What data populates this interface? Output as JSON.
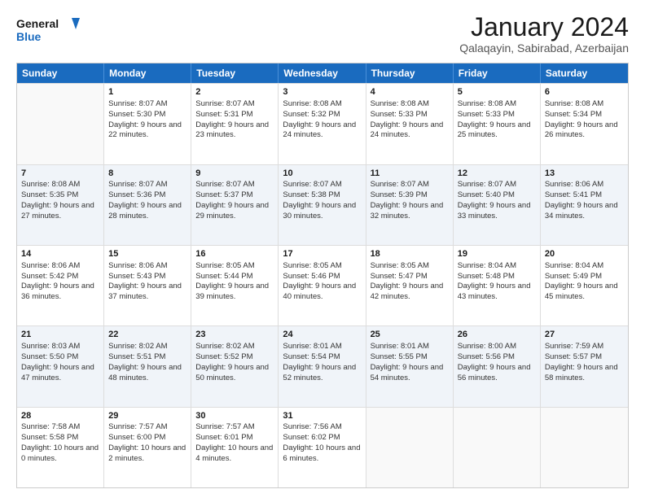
{
  "logo": {
    "line1": "General",
    "line2": "Blue"
  },
  "title": "January 2024",
  "subtitle": "Qalaqayin, Sabirabad, Azerbaijan",
  "header_days": [
    "Sunday",
    "Monday",
    "Tuesday",
    "Wednesday",
    "Thursday",
    "Friday",
    "Saturday"
  ],
  "weeks": [
    [
      {
        "day": "",
        "sunrise": "",
        "sunset": "",
        "daylight": "",
        "alt": false
      },
      {
        "day": "1",
        "sunrise": "Sunrise: 8:07 AM",
        "sunset": "Sunset: 5:30 PM",
        "daylight": "Daylight: 9 hours and 22 minutes.",
        "alt": false
      },
      {
        "day": "2",
        "sunrise": "Sunrise: 8:07 AM",
        "sunset": "Sunset: 5:31 PM",
        "daylight": "Daylight: 9 hours and 23 minutes.",
        "alt": false
      },
      {
        "day": "3",
        "sunrise": "Sunrise: 8:08 AM",
        "sunset": "Sunset: 5:32 PM",
        "daylight": "Daylight: 9 hours and 24 minutes.",
        "alt": false
      },
      {
        "day": "4",
        "sunrise": "Sunrise: 8:08 AM",
        "sunset": "Sunset: 5:33 PM",
        "daylight": "Daylight: 9 hours and 24 minutes.",
        "alt": false
      },
      {
        "day": "5",
        "sunrise": "Sunrise: 8:08 AM",
        "sunset": "Sunset: 5:33 PM",
        "daylight": "Daylight: 9 hours and 25 minutes.",
        "alt": false
      },
      {
        "day": "6",
        "sunrise": "Sunrise: 8:08 AM",
        "sunset": "Sunset: 5:34 PM",
        "daylight": "Daylight: 9 hours and 26 minutes.",
        "alt": false
      }
    ],
    [
      {
        "day": "7",
        "sunrise": "Sunrise: 8:08 AM",
        "sunset": "Sunset: 5:35 PM",
        "daylight": "Daylight: 9 hours and 27 minutes.",
        "alt": true
      },
      {
        "day": "8",
        "sunrise": "Sunrise: 8:07 AM",
        "sunset": "Sunset: 5:36 PM",
        "daylight": "Daylight: 9 hours and 28 minutes.",
        "alt": true
      },
      {
        "day": "9",
        "sunrise": "Sunrise: 8:07 AM",
        "sunset": "Sunset: 5:37 PM",
        "daylight": "Daylight: 9 hours and 29 minutes.",
        "alt": true
      },
      {
        "day": "10",
        "sunrise": "Sunrise: 8:07 AM",
        "sunset": "Sunset: 5:38 PM",
        "daylight": "Daylight: 9 hours and 30 minutes.",
        "alt": true
      },
      {
        "day": "11",
        "sunrise": "Sunrise: 8:07 AM",
        "sunset": "Sunset: 5:39 PM",
        "daylight": "Daylight: 9 hours and 32 minutes.",
        "alt": true
      },
      {
        "day": "12",
        "sunrise": "Sunrise: 8:07 AM",
        "sunset": "Sunset: 5:40 PM",
        "daylight": "Daylight: 9 hours and 33 minutes.",
        "alt": true
      },
      {
        "day": "13",
        "sunrise": "Sunrise: 8:06 AM",
        "sunset": "Sunset: 5:41 PM",
        "daylight": "Daylight: 9 hours and 34 minutes.",
        "alt": true
      }
    ],
    [
      {
        "day": "14",
        "sunrise": "Sunrise: 8:06 AM",
        "sunset": "Sunset: 5:42 PM",
        "daylight": "Daylight: 9 hours and 36 minutes.",
        "alt": false
      },
      {
        "day": "15",
        "sunrise": "Sunrise: 8:06 AM",
        "sunset": "Sunset: 5:43 PM",
        "daylight": "Daylight: 9 hours and 37 minutes.",
        "alt": false
      },
      {
        "day": "16",
        "sunrise": "Sunrise: 8:05 AM",
        "sunset": "Sunset: 5:44 PM",
        "daylight": "Daylight: 9 hours and 39 minutes.",
        "alt": false
      },
      {
        "day": "17",
        "sunrise": "Sunrise: 8:05 AM",
        "sunset": "Sunset: 5:46 PM",
        "daylight": "Daylight: 9 hours and 40 minutes.",
        "alt": false
      },
      {
        "day": "18",
        "sunrise": "Sunrise: 8:05 AM",
        "sunset": "Sunset: 5:47 PM",
        "daylight": "Daylight: 9 hours and 42 minutes.",
        "alt": false
      },
      {
        "day": "19",
        "sunrise": "Sunrise: 8:04 AM",
        "sunset": "Sunset: 5:48 PM",
        "daylight": "Daylight: 9 hours and 43 minutes.",
        "alt": false
      },
      {
        "day": "20",
        "sunrise": "Sunrise: 8:04 AM",
        "sunset": "Sunset: 5:49 PM",
        "daylight": "Daylight: 9 hours and 45 minutes.",
        "alt": false
      }
    ],
    [
      {
        "day": "21",
        "sunrise": "Sunrise: 8:03 AM",
        "sunset": "Sunset: 5:50 PM",
        "daylight": "Daylight: 9 hours and 47 minutes.",
        "alt": true
      },
      {
        "day": "22",
        "sunrise": "Sunrise: 8:02 AM",
        "sunset": "Sunset: 5:51 PM",
        "daylight": "Daylight: 9 hours and 48 minutes.",
        "alt": true
      },
      {
        "day": "23",
        "sunrise": "Sunrise: 8:02 AM",
        "sunset": "Sunset: 5:52 PM",
        "daylight": "Daylight: 9 hours and 50 minutes.",
        "alt": true
      },
      {
        "day": "24",
        "sunrise": "Sunrise: 8:01 AM",
        "sunset": "Sunset: 5:54 PM",
        "daylight": "Daylight: 9 hours and 52 minutes.",
        "alt": true
      },
      {
        "day": "25",
        "sunrise": "Sunrise: 8:01 AM",
        "sunset": "Sunset: 5:55 PM",
        "daylight": "Daylight: 9 hours and 54 minutes.",
        "alt": true
      },
      {
        "day": "26",
        "sunrise": "Sunrise: 8:00 AM",
        "sunset": "Sunset: 5:56 PM",
        "daylight": "Daylight: 9 hours and 56 minutes.",
        "alt": true
      },
      {
        "day": "27",
        "sunrise": "Sunrise: 7:59 AM",
        "sunset": "Sunset: 5:57 PM",
        "daylight": "Daylight: 9 hours and 58 minutes.",
        "alt": true
      }
    ],
    [
      {
        "day": "28",
        "sunrise": "Sunrise: 7:58 AM",
        "sunset": "Sunset: 5:58 PM",
        "daylight": "Daylight: 10 hours and 0 minutes.",
        "alt": false
      },
      {
        "day": "29",
        "sunrise": "Sunrise: 7:57 AM",
        "sunset": "Sunset: 6:00 PM",
        "daylight": "Daylight: 10 hours and 2 minutes.",
        "alt": false
      },
      {
        "day": "30",
        "sunrise": "Sunrise: 7:57 AM",
        "sunset": "Sunset: 6:01 PM",
        "daylight": "Daylight: 10 hours and 4 minutes.",
        "alt": false
      },
      {
        "day": "31",
        "sunrise": "Sunrise: 7:56 AM",
        "sunset": "Sunset: 6:02 PM",
        "daylight": "Daylight: 10 hours and 6 minutes.",
        "alt": false
      },
      {
        "day": "",
        "sunrise": "",
        "sunset": "",
        "daylight": "",
        "alt": false
      },
      {
        "day": "",
        "sunrise": "",
        "sunset": "",
        "daylight": "",
        "alt": false
      },
      {
        "day": "",
        "sunrise": "",
        "sunset": "",
        "daylight": "",
        "alt": false
      }
    ]
  ]
}
